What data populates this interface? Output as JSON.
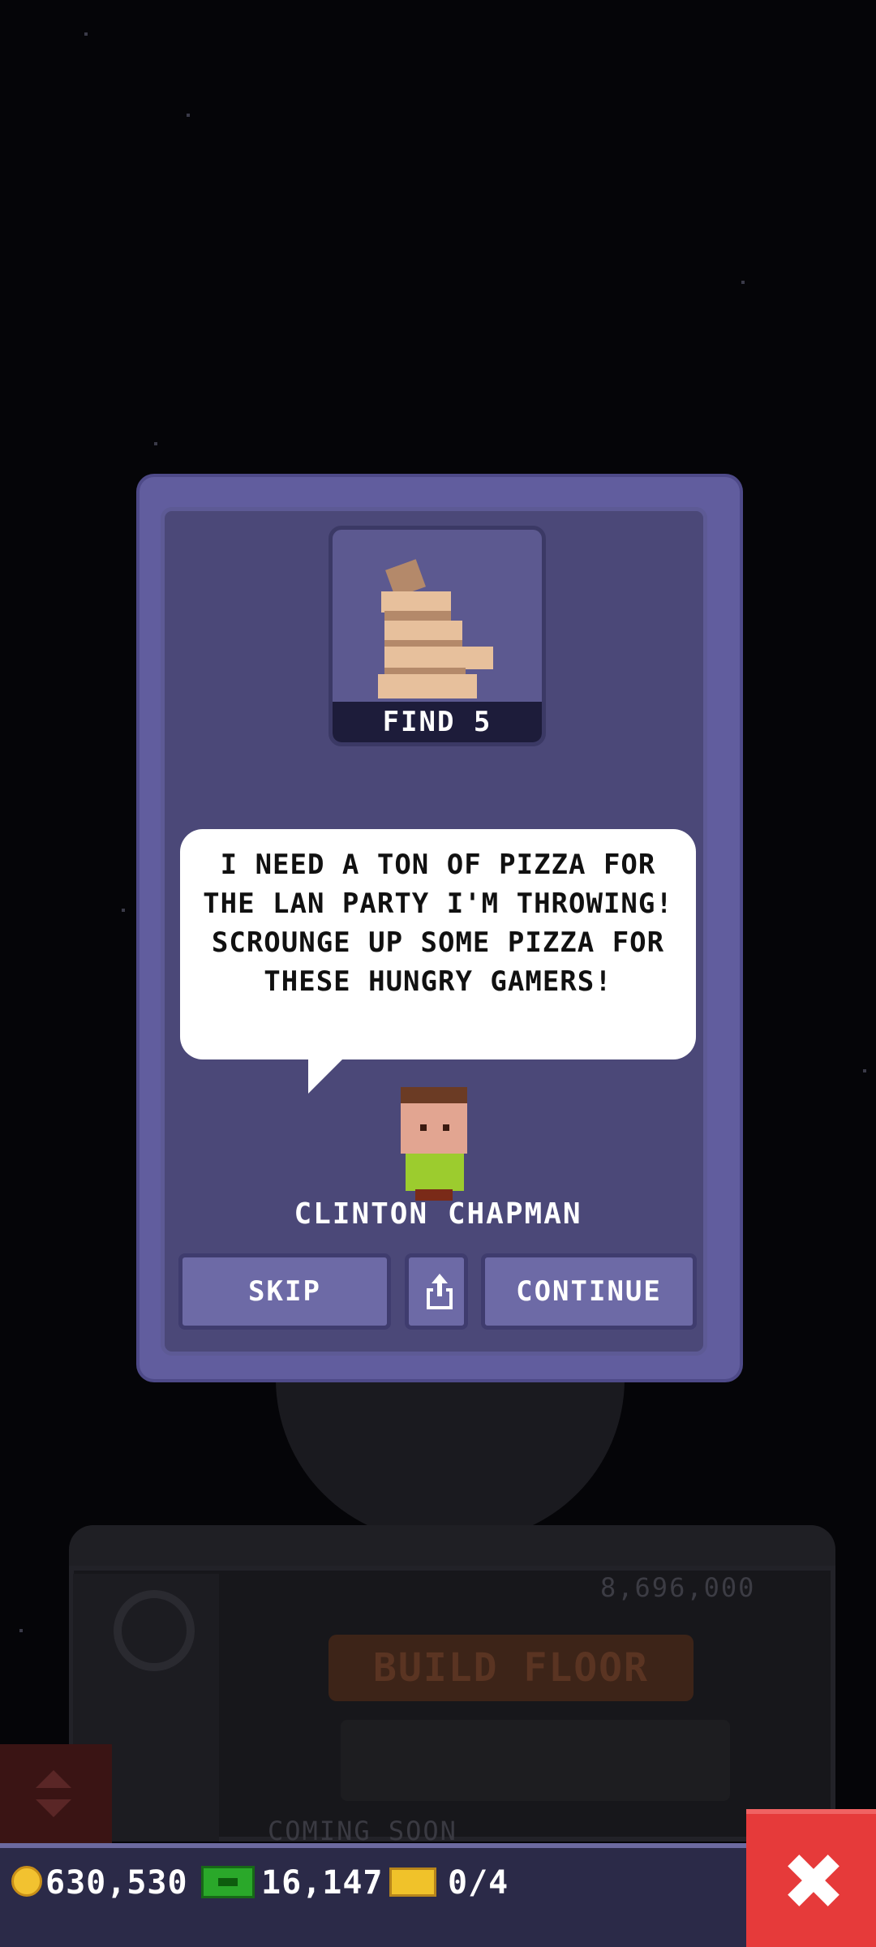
{
  "quest": {
    "goal_label": "FIND 5",
    "item_icon": "pizza-stack-icon",
    "message": "I NEED A TON OF PIZZA FOR THE LAN PARTY I'M THROWING! SCROUNGE UP SOME PIZZA FOR THESE HUNGRY GAMERS!",
    "character_name": "CLINTON CHAPMAN",
    "buttons": {
      "skip": "SKIP",
      "share_icon": "share-icon",
      "continue": "CONTINUE"
    }
  },
  "background": {
    "build_cost": "8,696,000",
    "build_floor_label": "BUILD FLOOR",
    "coming_soon": "COMING SOON"
  },
  "hud": {
    "coins": "630,530",
    "bux": "16,147",
    "tickets": "0/4",
    "close_icon": "close-x-icon"
  },
  "colors": {
    "modal": "#615d9e",
    "modal_inner": "#4b4878",
    "button": "#6d6aa6",
    "close": "#e63a3a",
    "hud": "#2b2a48"
  }
}
